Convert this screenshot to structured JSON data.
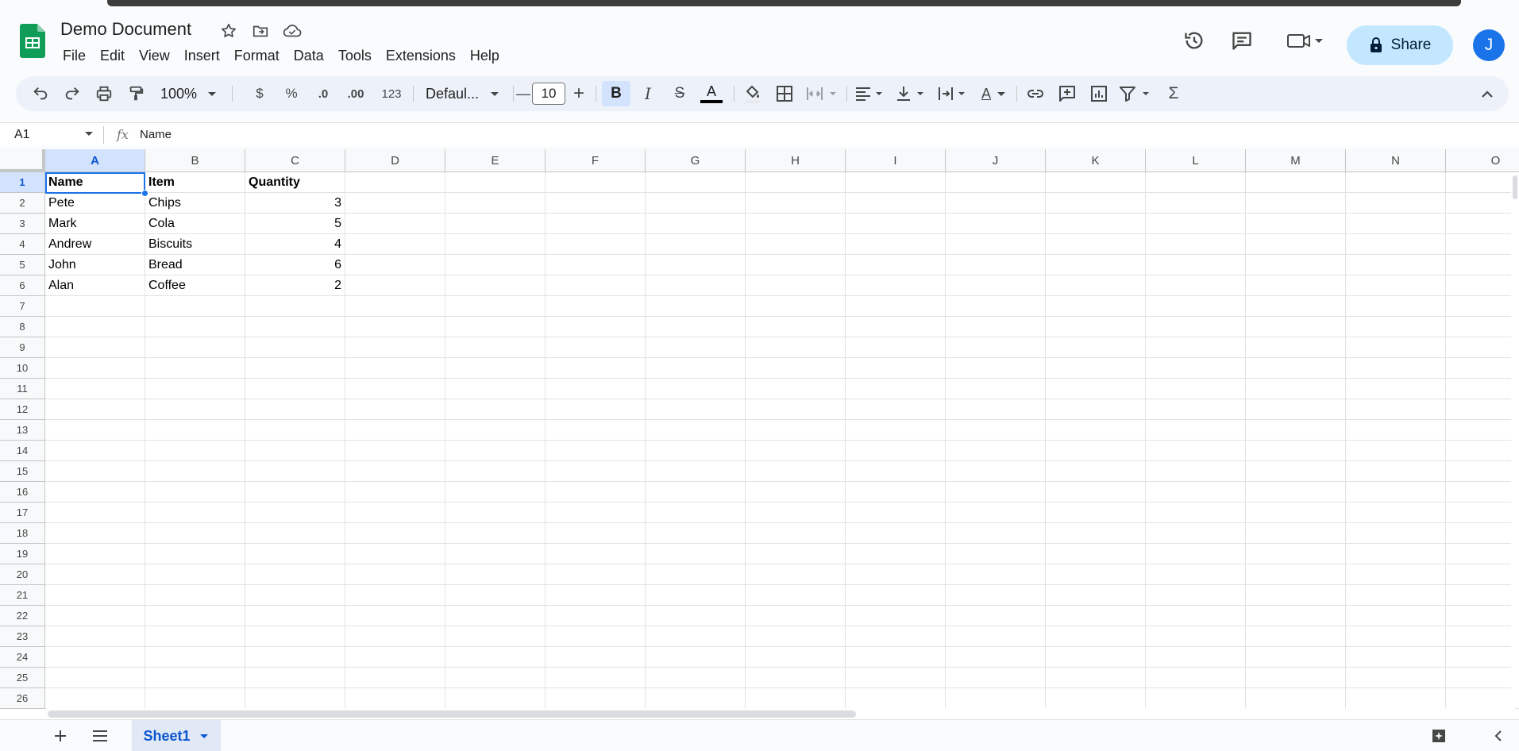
{
  "doc": {
    "title": "Demo Document"
  },
  "menu": [
    "File",
    "Edit",
    "View",
    "Insert",
    "Format",
    "Data",
    "Tools",
    "Extensions",
    "Help"
  ],
  "header": {
    "share_label": "Share",
    "avatar_initial": "J"
  },
  "toolbar": {
    "zoom": "100%",
    "currency": "$",
    "percent": "%",
    "decrease_decimal": ".0",
    "increase_decimal": ".00",
    "number_format": "123",
    "font": "Defaul...",
    "font_size": "10",
    "bold": "B",
    "italic": "I",
    "strike": "S",
    "text_color": "A",
    "text_rotation": "A",
    "sigma": "Σ",
    "minus": "—",
    "plus": "+"
  },
  "formula_bar": {
    "cell_ref": "A1",
    "fx": "fx",
    "value": "Name"
  },
  "sheet": {
    "columns": [
      "A",
      "B",
      "C",
      "D",
      "E",
      "F",
      "G",
      "H",
      "I",
      "J",
      "K",
      "L",
      "M",
      "N",
      "O"
    ],
    "rows": [
      "1",
      "2",
      "3",
      "4",
      "5",
      "6",
      "7",
      "8",
      "9",
      "10",
      "11",
      "12",
      "13",
      "14",
      "15",
      "16",
      "17",
      "18",
      "19",
      "20",
      "21",
      "22",
      "23",
      "24",
      "25",
      "26"
    ],
    "header_row": [
      "Name",
      "Item",
      "Quantity"
    ],
    "data": [
      [
        "Pete",
        "Chips",
        "3"
      ],
      [
        "Mark",
        "Cola",
        "5"
      ],
      [
        "Andrew",
        "Biscuits",
        "4"
      ],
      [
        "John",
        "Bread",
        "6"
      ],
      [
        "Alan",
        "Coffee",
        "2"
      ]
    ]
  },
  "tabs": {
    "sheet_name": "Sheet1"
  },
  "colors": {
    "accent": "#1a73e8",
    "share_bg": "#c2e7ff",
    "selection": "#d3e3fd",
    "sheets_green": "#0f9d58"
  }
}
